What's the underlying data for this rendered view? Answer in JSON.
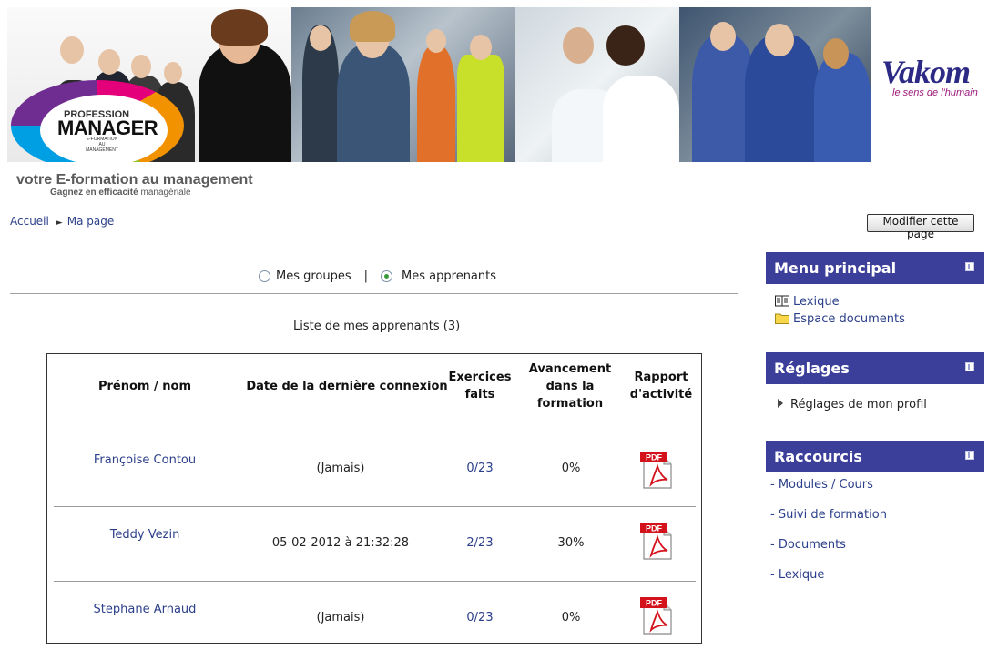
{
  "banner": {
    "logo_top": "PROFESSION",
    "logo_main": "MANAGER",
    "logo_sub": "E-FORMATION AU MANAGEMENT",
    "tagline": "votre E-formation au management",
    "tagline_sub_bold": "Gagnez en efficacité",
    "tagline_sub": "managériale",
    "vakom_word": "Vakom",
    "vakom_tag": "le sens de l'humain"
  },
  "breadcrumb": {
    "home": "Accueil",
    "current": "Ma page"
  },
  "edit_button": "Modifier cette page",
  "view_toggle": {
    "groups_label": "Mes groupes",
    "separator": "|",
    "learners_label": "Mes apprenants",
    "selected": "learners"
  },
  "list_title": "Liste de mes apprenants (3)",
  "table": {
    "headers": {
      "name": "Prénom / nom",
      "last_login": "Date de la dernière connexion",
      "exercises_1": "Exercices",
      "exercises_2": "faits",
      "progress_1": "Avancement",
      "progress_2": "dans la",
      "progress_3": "formation",
      "report_1": "Rapport",
      "report_2": "d'activité"
    },
    "rows": [
      {
        "name": "Françoise Contou",
        "last_login": "(Jamais)",
        "exercises": "0/23",
        "progress": "0%",
        "report": "PDF"
      },
      {
        "name": "Teddy Vezin",
        "last_login": "05-02-2012 à 21:32:28",
        "exercises": "2/23",
        "progress": "30%",
        "report": "PDF"
      },
      {
        "name": "Stephane Arnaud",
        "last_login": "(Jamais)",
        "exercises": "0/23",
        "progress": "0%",
        "report": "PDF"
      }
    ]
  },
  "sidebar": {
    "main_menu": {
      "title": "Menu principal",
      "items": [
        {
          "label": "Lexique",
          "icon": "glossary-icon"
        },
        {
          "label": "Espace documents",
          "icon": "folder-icon"
        }
      ]
    },
    "settings": {
      "title": "Réglages",
      "items": [
        {
          "label": "Réglages de mon profil"
        }
      ]
    },
    "shortcuts": {
      "title": "Raccourcis",
      "prefix": "- ",
      "items": [
        {
          "label": "Modules / Cours"
        },
        {
          "label": "Suivi de formation"
        },
        {
          "label": "Documents"
        },
        {
          "label": "Lexique"
        }
      ]
    }
  },
  "colors": {
    "block_header": "#3b3f9a",
    "link": "#2b3f8a",
    "vakom_purple": "#2d2a86",
    "vakom_tag": "#9b1a7a",
    "pdf_red": "#d4121b"
  }
}
